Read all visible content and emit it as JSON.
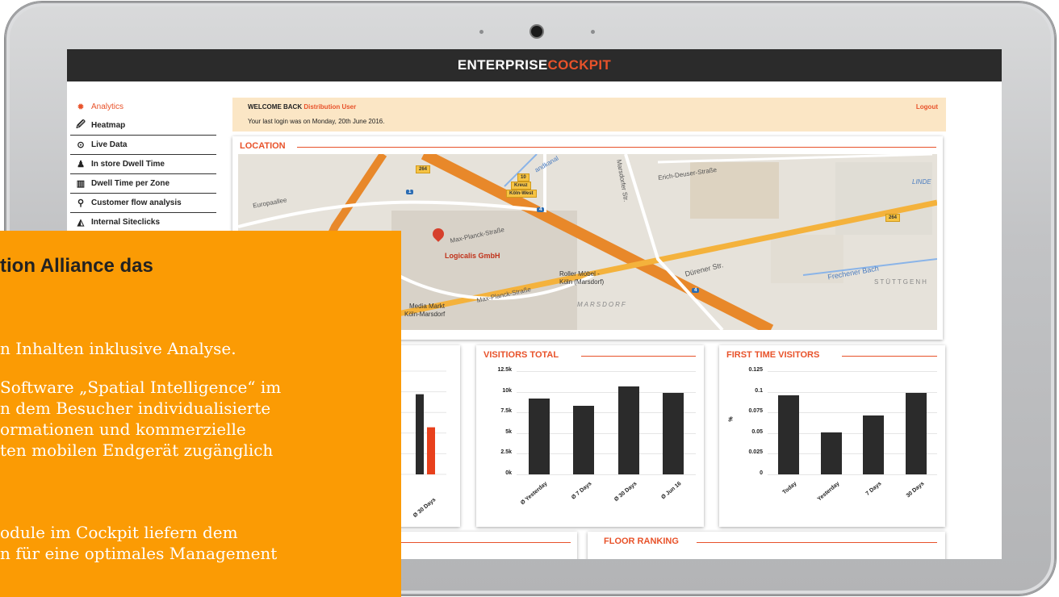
{
  "brand": {
    "part1": "ENTERPRISE",
    "part2": "COCKPIT"
  },
  "sidebar": {
    "items": [
      {
        "icon": "analytics-icon",
        "glyph": "✹",
        "label": "Analytics"
      },
      {
        "icon": "heatmap-icon",
        "glyph": "🖉",
        "label": "Heatmap"
      },
      {
        "icon": "clock-icon",
        "glyph": "⊙",
        "label": "Live Data"
      },
      {
        "icon": "walker-icon",
        "glyph": "♟",
        "label": "In store Dwell Time"
      },
      {
        "icon": "map-icon",
        "glyph": "▥",
        "label": "Dwell Time per Zone"
      },
      {
        "icon": "search-icon",
        "glyph": "⚲",
        "label": "Customer flow analysis"
      },
      {
        "icon": "area-chart-icon",
        "glyph": "◭",
        "label": "Internal Siteclicks"
      }
    ]
  },
  "welcome": {
    "prefix": "WELCOME BACK",
    "user": "Distribution User",
    "last_login": "Your last login was on Monday, 20th June 2016.",
    "logout": "Logout"
  },
  "location": {
    "title": "LOCATION",
    "labels": {
      "place": "Logicalis GmbH",
      "street1": "Max-Planck-Straße",
      "street2": "Max-Planck-Straße",
      "europa": "Europaallee",
      "erich": "Erich-Deuser-Straße",
      "marsdorfer": "Marsdorfer Str.",
      "dueren": "Dürener Str.",
      "frechen": "Frechener Bach",
      "marsdorf": "MARSDORF",
      "roller": "Roller Möbel -",
      "roller2": "Köln (Marsdorf)",
      "media": "Media Markt",
      "media2": "Köln-Marsdorf",
      "kreuz": "10",
      "kreuz2": "Kreuz",
      "kreuz3": "Köln-West",
      "linde": "LINDE",
      "stuttgen": "STÜTTGENH",
      "kanal": "andkanal",
      "europa2": "Europaall"
    },
    "shields": {
      "a": "264",
      "b": "1",
      "c": "4",
      "d": "264",
      "e": "4"
    }
  },
  "charts": {
    "visitors": {
      "title": "VISITIORS TOTAL",
      "yticks": [
        "12.5k",
        "10k",
        "7.5k",
        "5k",
        "2.5k",
        "0k"
      ]
    },
    "first": {
      "title": "FIRST TIME VISITORS",
      "ylabel": "%",
      "yticks": [
        "0.125",
        "0.1",
        "0.075",
        "0.05",
        "0.025",
        "0"
      ]
    },
    "left_partial": {
      "xlabel": "Ø 30 Days"
    }
  },
  "chart_data": [
    {
      "type": "bar",
      "title": "VISITIORS TOTAL",
      "categories": [
        "Ø Yesterday",
        "Ø 7 Days",
        "Ø 30 Days",
        "Ø Jun 16"
      ],
      "values": [
        9200,
        8300,
        10600,
        9900
      ],
      "ylim": [
        0,
        12500
      ]
    },
    {
      "type": "bar",
      "title": "FIRST TIME VISITORS",
      "ylabel": "%",
      "categories": [
        "Today",
        "Yesterday",
        "7 Days",
        "30 Days"
      ],
      "values": [
        0.096,
        0.051,
        0.071,
        0.099
      ],
      "ylim": [
        0,
        0.125
      ]
    },
    {
      "type": "bar",
      "categories": [
        "Ø 30 Days"
      ],
      "series": [
        {
          "color": "#2b2b2b",
          "values": [
            0.97
          ]
        },
        {
          "color": "#e8401c",
          "values": [
            0.57
          ]
        }
      ],
      "ylim": [
        0,
        1.25
      ]
    }
  ],
  "floor": {
    "title": "FLOOR RANKING"
  },
  "overlay": {
    "title": "tion Alliance das",
    "lines": [
      "n Inhalten inklusive Analyse.",
      "Software „Spatial Intelligence“ im",
      "n dem Besucher individualisierte",
      "ormationen und kommerzielle",
      "ten mobilen Endgerät zugänglich",
      "odule im Cockpit liefern dem",
      "n für eine optimales Management"
    ]
  },
  "colors": {
    "accent": "#e8522a",
    "overlay": "#fb9b04",
    "bar": "#2b2b2b"
  }
}
